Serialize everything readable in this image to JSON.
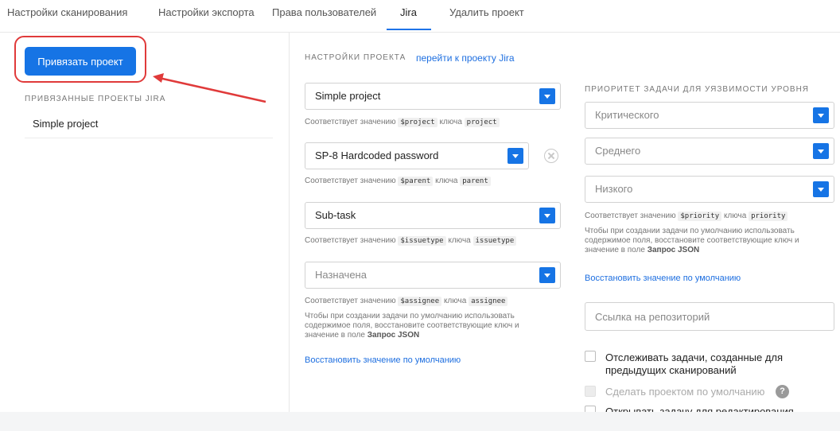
{
  "tabs": [
    {
      "label": "Настройки сканирования"
    },
    {
      "label": "Настройки экспорта"
    },
    {
      "label": "Права пользователей"
    },
    {
      "label": "Jira"
    },
    {
      "label": "Удалить проект"
    }
  ],
  "left": {
    "link_button": "Привязать проект",
    "linked_title": "ПРИВЯЗАННЫЕ ПРОЕКТЫ JIRA",
    "linked_items": [
      "Simple project"
    ]
  },
  "settings": {
    "title": "НАСТРОЙКИ ПРОЕКТА",
    "goto_link": "перейти к проекту Jira",
    "project": {
      "value": "Simple project",
      "hint_prefix": "Соответствует значению",
      "hint_var": "$project",
      "hint_mid": "ключа",
      "hint_key": "project"
    },
    "parent": {
      "value": "SP-8 Hardcoded password",
      "hint_prefix": "Соответствует значению",
      "hint_var": "$parent",
      "hint_mid": "ключа",
      "hint_key": "parent"
    },
    "issuetype": {
      "value": "Sub-task",
      "hint_prefix": "Соответствует значению",
      "hint_var": "$issuetype",
      "hint_mid": "ключа",
      "hint_key": "issuetype"
    },
    "assignee": {
      "placeholder": "Назначена",
      "hint_prefix": "Соответствует значению",
      "hint_var": "$assignee",
      "hint_mid": "ключа",
      "hint_key": "assignee",
      "note_lines": [
        "Чтобы при создании задачи по умолчанию использовать",
        "содержимое поля, восстановите соответствующие ключ и",
        "значение в поле"
      ],
      "note_bold": "Запрос JSON"
    },
    "restore": "Восстановить значение по умолчанию"
  },
  "priority": {
    "title": "ПРИОРИТЕТ ЗАДАЧИ ДЛЯ УЯЗВИМОСТИ УРОВНЯ",
    "critical": "Критического",
    "medium": "Среднего",
    "low": "Низкого",
    "hint_prefix": "Соответствует значению",
    "hint_var": "$priority",
    "hint_mid": "ключа",
    "hint_key": "priority",
    "note_lines": [
      "Чтобы при создании задачи по умолчанию использовать",
      "содержимое поля, восстановите соответствующие ключ и",
      "значение в поле"
    ],
    "note_bold": "Запрос JSON",
    "restore": "Восстановить значение по умолчанию",
    "repo_placeholder": "Ссылка на репозиторий",
    "track_line1": "Отслеживать задачи, созданные для",
    "track_line2": "предыдущих сканирований",
    "default_project": "Сделать проектом по умолчанию",
    "help": "?",
    "open_edit": "Открывать задачу для редактирования"
  }
}
